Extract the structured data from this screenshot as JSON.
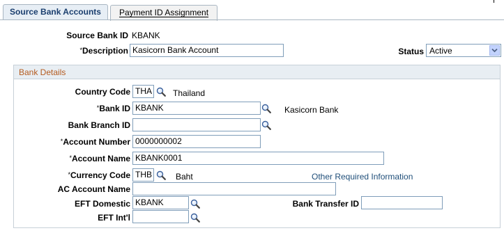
{
  "tabs": {
    "active": "Source Bank Accounts",
    "inactive": "Payment ID Assignment"
  },
  "header": {
    "source_bank_id_label": "Source Bank ID",
    "source_bank_id_value": "KBANK",
    "description_label": "Description",
    "description_value": "Kasicorn Bank Account",
    "status_label": "Status",
    "status_value": "Active"
  },
  "bank_details": {
    "title": "Bank Details",
    "country_code_label": "Country Code",
    "country_code_value": "THA",
    "country_name": "Thailand",
    "bank_id_label": "Bank ID",
    "bank_id_value": "KBANK",
    "bank_name": "Kasicorn Bank",
    "bank_branch_id_label": "Bank Branch ID",
    "bank_branch_id_value": "",
    "account_number_label": "Account Number",
    "account_number_value": "0000000002",
    "account_name_label": "Account Name",
    "account_name_value": "KBANK0001",
    "currency_code_label": "Currency Code",
    "currency_code_value": "THB",
    "currency_name": "Baht",
    "other_info_link": "Other Required Information",
    "ac_account_name_label": "AC Account Name",
    "ac_account_name_value": "",
    "eft_domestic_label": "EFT Domestic",
    "eft_domestic_value": "KBANK",
    "bank_transfer_id_label": "Bank Transfer ID",
    "bank_transfer_id_value": "",
    "eft_intl_label": "EFT Int'l",
    "eft_intl_value": ""
  },
  "required_marker": "*",
  "icons": {
    "lookup": "magnifier-lookup-icon",
    "dropdown": "chevron-down-icon"
  }
}
